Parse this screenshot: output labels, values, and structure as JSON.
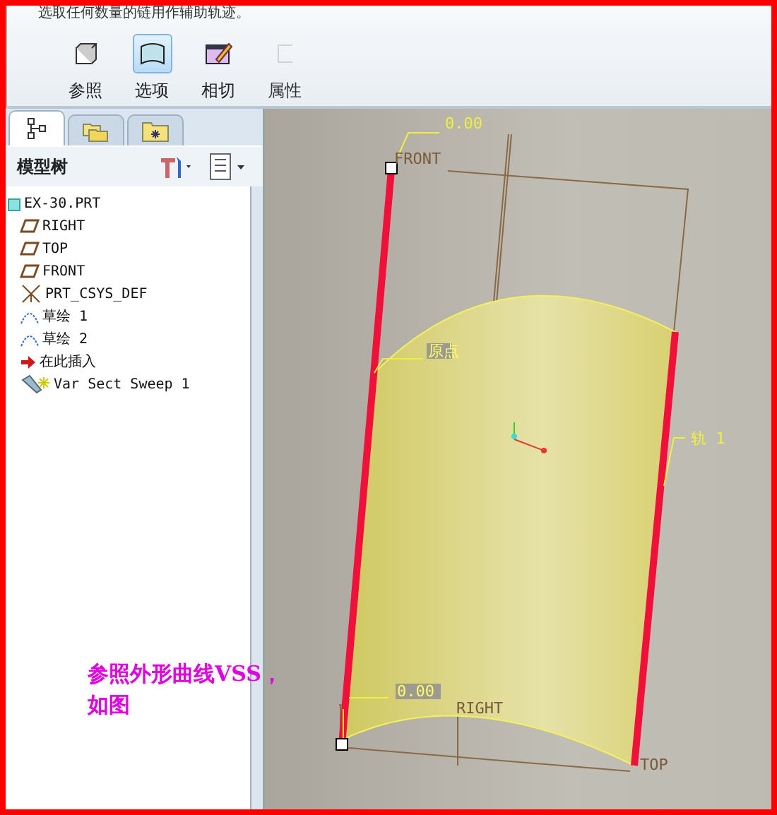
{
  "prompt": "选取任何数量的链用作辅助轨迹。",
  "dashboard": {
    "tools": [
      {
        "label": "参照",
        "kind": "references",
        "selected": false,
        "disabled": false
      },
      {
        "label": "选项",
        "kind": "options",
        "selected": true,
        "disabled": false
      },
      {
        "label": "相切",
        "kind": "tangency",
        "selected": false,
        "disabled": false
      },
      {
        "label": "属性",
        "kind": "properties",
        "selected": false,
        "disabled": true
      }
    ]
  },
  "navigator": {
    "tabs": [
      {
        "kind": "tree",
        "selected": true
      },
      {
        "kind": "folders",
        "selected": false
      },
      {
        "kind": "favorites",
        "selected": false
      }
    ],
    "title": "模型树",
    "tree": [
      {
        "label": "EX-30.PRT",
        "kind": "part",
        "children": [
          {
            "label": "RIGHT",
            "kind": "plane"
          },
          {
            "label": "TOP",
            "kind": "plane"
          },
          {
            "label": "FRONT",
            "kind": "plane"
          },
          {
            "label": "PRT_CSYS_DEF",
            "kind": "csys"
          },
          {
            "label": "草绘 1",
            "kind": "sketch"
          },
          {
            "label": "草绘 2",
            "kind": "sketch"
          },
          {
            "label": "在此插入",
            "kind": "insert"
          },
          {
            "label": "Var Sect Sweep 1",
            "kind": "sweep"
          }
        ]
      }
    ]
  },
  "viewport": {
    "labels": [
      {
        "text": "0.00",
        "kind": "dimension"
      },
      {
        "text": "FRONT",
        "kind": "datum"
      },
      {
        "text": "原点",
        "kind": "tag"
      },
      {
        "text": "轨 1",
        "kind": "dimension"
      },
      {
        "text": "0.00",
        "kind": "tag"
      },
      {
        "text": "RIGHT",
        "kind": "datum"
      },
      {
        "text": "TOP",
        "kind": "datum"
      }
    ]
  },
  "annotation": {
    "lines": [
      "参照外形曲线VSS，",
      "如图"
    ]
  }
}
